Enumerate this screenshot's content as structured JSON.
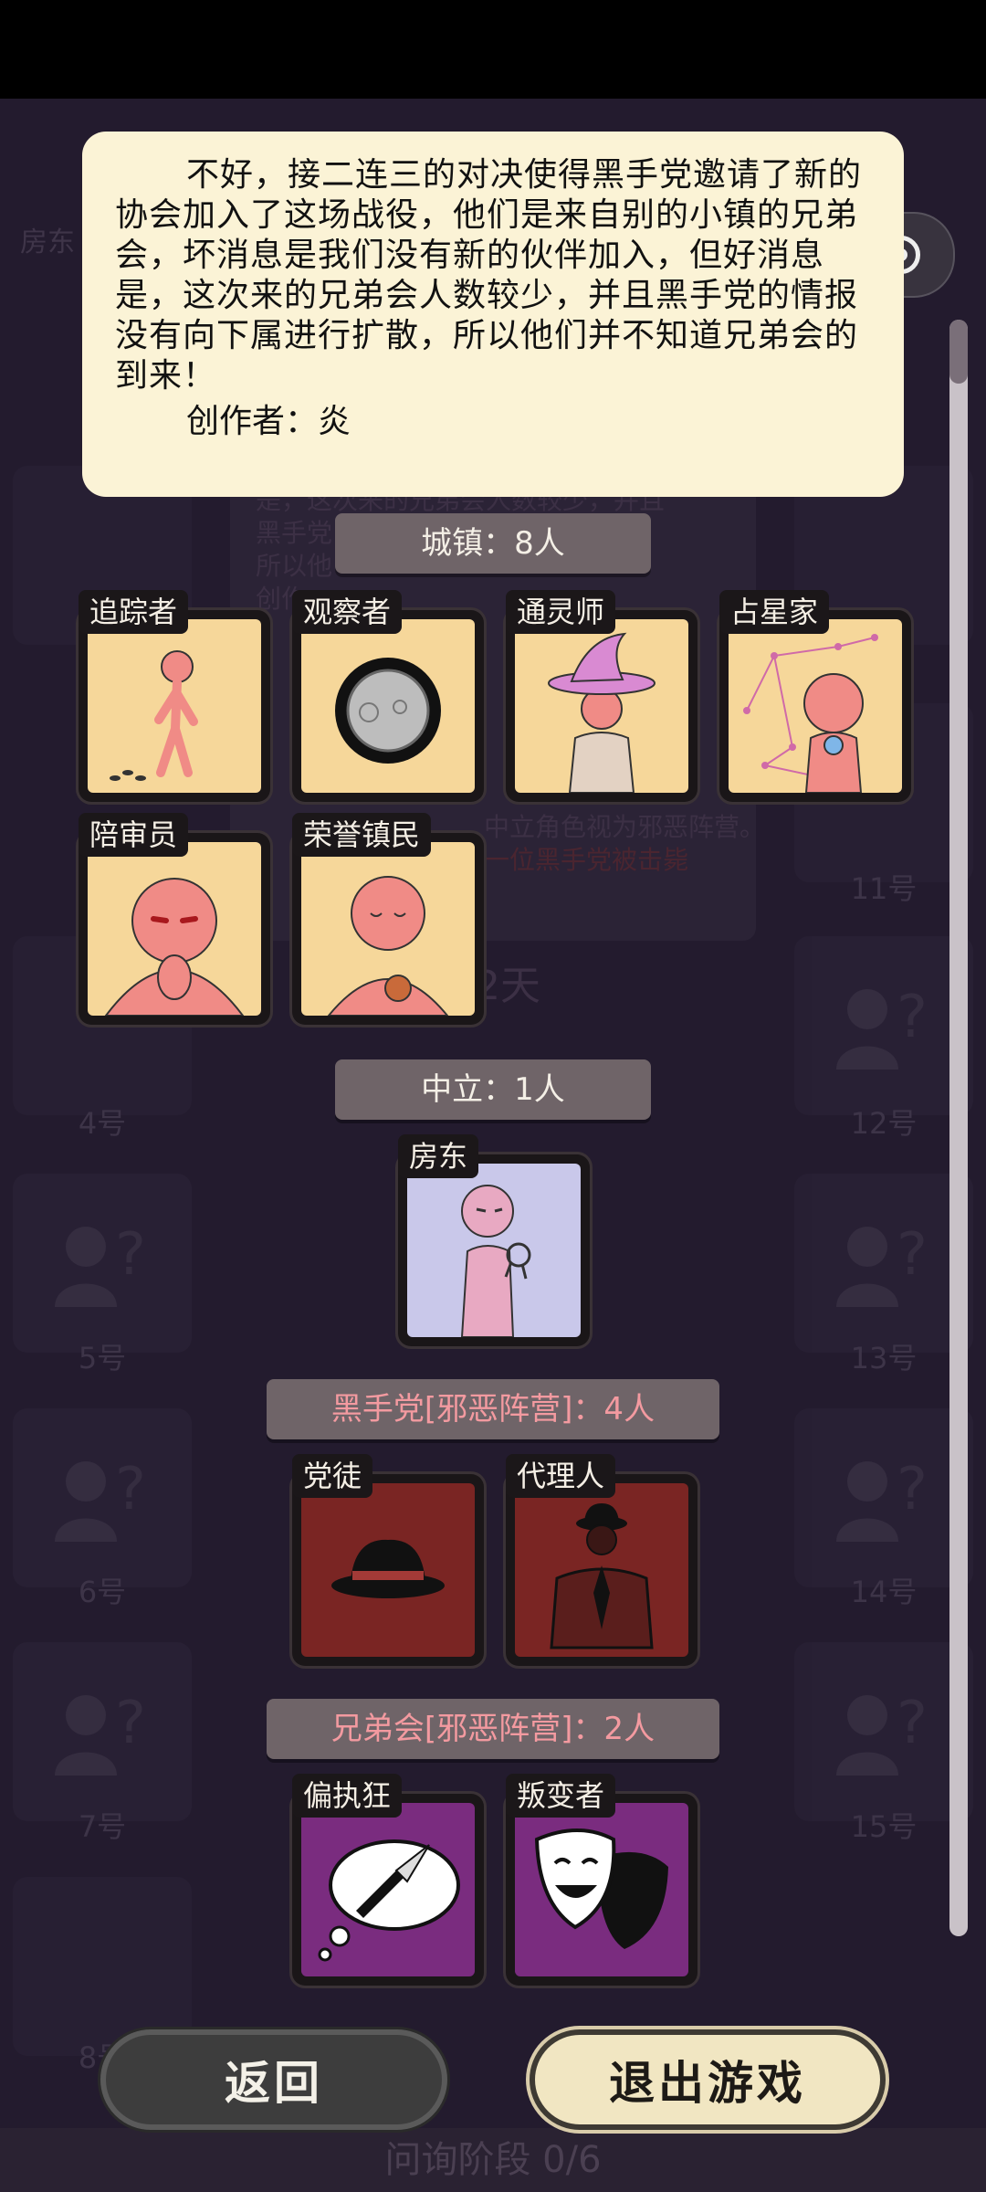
{
  "story": {
    "text": "不好，接二连三的对决使得黑手党邀请了新的协会加入了这场战役，他们是来自别的小镇的兄弟会，坏消息是我们没有新的伙伴加入，但好消息是，这次来的兄弟会人数较少，并且黑手党的情报没有向下属进行扩散，所以他们并不知道兄弟会的到来！",
    "author": "创作者：炎"
  },
  "background": {
    "top_left_role": "房东",
    "seat_numbers": [
      "4号",
      "5号",
      "6号",
      "7号",
      "8号",
      "11号",
      "12号",
      "13号",
      "14号",
      "15号"
    ],
    "panel_lines": [
      "是，这次来的兄弟会人数较少，并且",
      "黑手党",
      "所以他",
      "创作"
    ],
    "panel_day": "2天",
    "panel_hint": "中立角色视为邪恶阵营。",
    "panel_win": "一位黑手党被击毙"
  },
  "groups": {
    "town": {
      "header": "城镇：8人",
      "roles": [
        "追踪者",
        "观察者",
        "通灵师",
        "占星家",
        "陪审员",
        "荣誉镇民"
      ]
    },
    "neutral": {
      "header": "中立：1人",
      "roles": [
        "房东"
      ]
    },
    "mafia": {
      "header": "黑手党[邪恶阵营]：4人",
      "roles": [
        "党徒",
        "代理人"
      ]
    },
    "brotherhood": {
      "header": "兄弟会[邪恶阵营]：2人",
      "roles": [
        "偏执狂",
        "叛变者"
      ]
    }
  },
  "buttons": {
    "back": "返回",
    "exit": "退出游戏"
  },
  "footer": {
    "phase": "问询阶段 0/6"
  },
  "colors": {
    "town_card": "#f6d79a",
    "neutral_card": "#c9c8ea",
    "mafia_card": "#7a2523",
    "brotherhood_card": "#7a2c7f",
    "evil_header_text": "#f39aa0"
  }
}
